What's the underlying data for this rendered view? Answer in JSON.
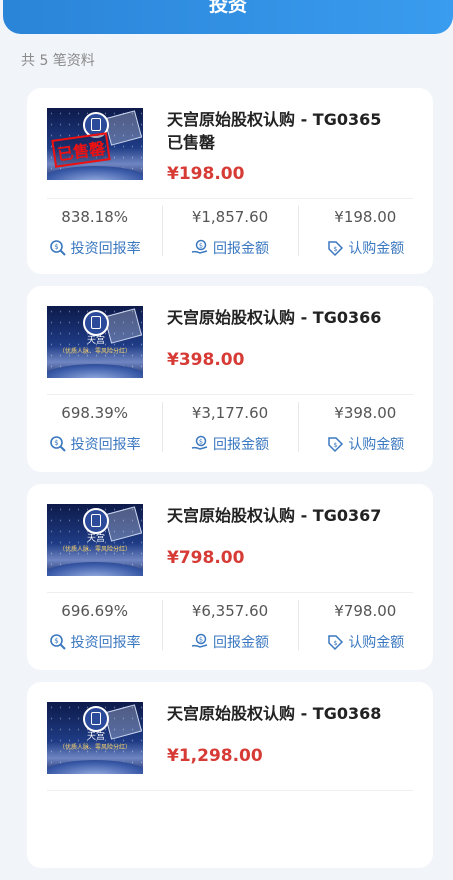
{
  "header": {
    "title": "投资"
  },
  "list_count": "共 5 笔资料",
  "stat_labels": {
    "rate": "投资回报率",
    "return": "回报金额",
    "purchase": "认购金额"
  },
  "thumb_text": {
    "tg": "天宫",
    "strip": "（优质人脉、零风险分红）",
    "stamp": "已售罄"
  },
  "colors": {
    "accent": "#2a84d8",
    "price": "#d73b36",
    "label": "#3b78c0"
  },
  "items": [
    {
      "name": "天宫原始股权认购",
      "code": "TG0365",
      "status": "已售罄",
      "price": "¥198.00",
      "rate": "838.18%",
      "return": "¥1,857.60",
      "purchase": "¥198.00"
    },
    {
      "name": "天宫原始股权认购",
      "code": "TG0366",
      "status": "",
      "price": "¥398.00",
      "rate": "698.39%",
      "return": "¥3,177.60",
      "purchase": "¥398.00"
    },
    {
      "name": "天宫原始股权认购",
      "code": "TG0367",
      "status": "",
      "price": "¥798.00",
      "rate": "696.69%",
      "return": "¥6,357.60",
      "purchase": "¥798.00"
    },
    {
      "name": "天宫原始股权认购",
      "code": "TG0368",
      "status": "",
      "price": "¥1,298.00",
      "rate": "",
      "return": "",
      "purchase": ""
    }
  ]
}
